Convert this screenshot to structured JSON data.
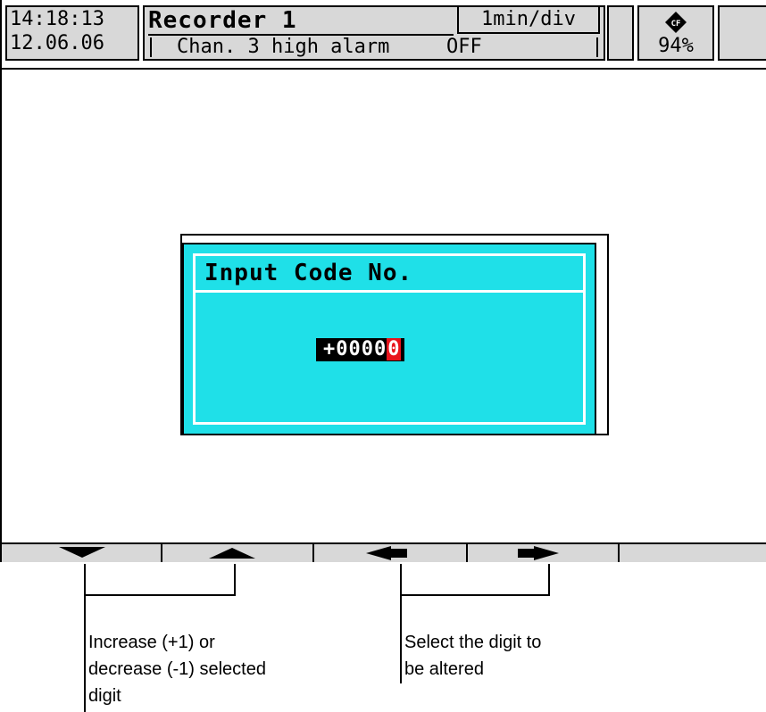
{
  "status": {
    "time": "14:18:13",
    "date": "12.06.06",
    "title": "Recorder 1",
    "timebase": "1min/div",
    "message": "Chan. 3 high alarm",
    "message_state": "OFF",
    "card_icon": "cf-card-icon",
    "card_percent": "94%"
  },
  "dialog": {
    "title": "Input Code No.",
    "code_prefix": "+0000",
    "code_selected_digit": "0"
  },
  "softkeys": [
    {
      "name": "softkey-down",
      "icon": "triangle-down-icon"
    },
    {
      "name": "softkey-up",
      "icon": "triangle-up-icon"
    },
    {
      "name": "softkey-left",
      "icon": "arrow-left-icon"
    },
    {
      "name": "softkey-right",
      "icon": "arrow-right-icon"
    },
    {
      "name": "softkey-empty",
      "icon": ""
    }
  ],
  "annotations": {
    "updown_line1": "Increase (+1) or",
    "updown_line2": "decrease (-1) selected",
    "updown_line3": "digit",
    "leftright_line1": "Select the digit to",
    "leftright_line2": "be altered"
  },
  "colors": {
    "dialog_bg": "#1fe0e8",
    "selected_digit": "#e8141c",
    "panel_gray": "#d8d8d8"
  }
}
